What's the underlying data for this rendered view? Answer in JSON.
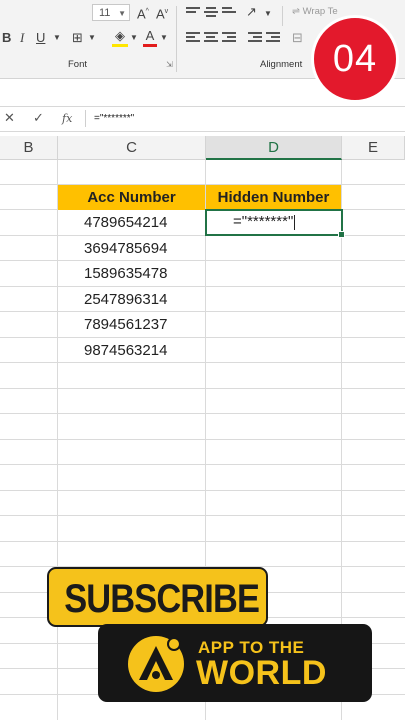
{
  "ribbon": {
    "font_size": "11",
    "font_group_label": "Font",
    "alignment_group_label": "Alignment",
    "wrap_text_label": "Wrap Te"
  },
  "badge": {
    "text": "04"
  },
  "formula_bar": {
    "content": "=\"*******\""
  },
  "columns": [
    "B",
    "C",
    "D",
    "E"
  ],
  "active_column": "D",
  "table": {
    "headers": [
      "Acc Number",
      "Hidden Number"
    ],
    "rows": [
      "4789654214",
      "3694785694",
      "1589635478",
      "2547896314",
      "7894561237",
      "9874563214"
    ],
    "editing_cell": "=\"*******\""
  },
  "overlay": {
    "subscribe": "SUBSCRIBE",
    "brand_line1": "APP TO THE",
    "brand_line2": "WORLD"
  },
  "colors": {
    "accent": "#217346",
    "header_fill": "#ffc000",
    "badge": "#e3192c",
    "brand_yellow": "#f5c21b"
  }
}
